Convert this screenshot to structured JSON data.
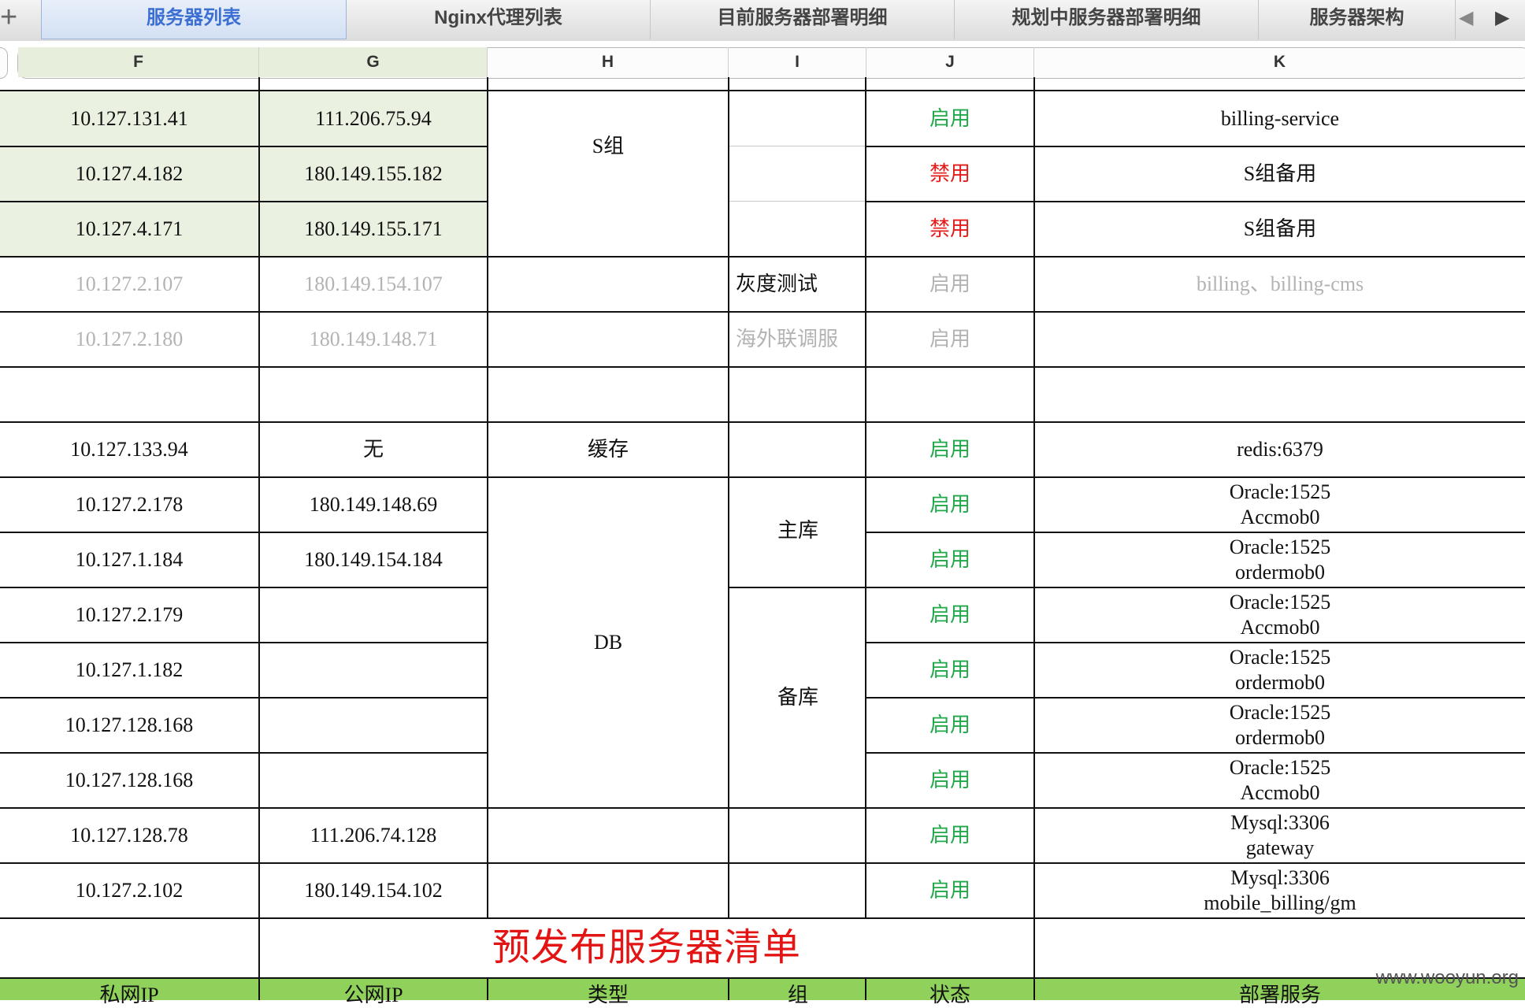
{
  "tabs": [
    {
      "label": "服务器列表",
      "active": true
    },
    {
      "label": "Nginx代理列表",
      "active": false
    },
    {
      "label": "目前服务器部署明细",
      "active": false
    },
    {
      "label": "规划中服务器部署明细",
      "active": false
    },
    {
      "label": "服务器架构",
      "active": false
    }
  ],
  "add_sheet_icon": "+",
  "nav_prev_icon": "◀",
  "nav_next_icon": "▶",
  "columns": [
    "F",
    "G",
    "H",
    "I",
    "J",
    "K"
  ],
  "rows": [
    {
      "private_ip": "10.127.131.41",
      "public_ip": "111.206.75.94",
      "status": "启用",
      "service": "billing-service"
    },
    {
      "private_ip": "10.127.4.182",
      "public_ip": "180.149.155.182",
      "status": "禁用",
      "service": "S组备用"
    },
    {
      "private_ip": "10.127.4.171",
      "public_ip": "180.149.155.171",
      "status": "禁用",
      "service": "S组备用"
    },
    {
      "private_ip": "10.127.2.107",
      "public_ip": "180.149.154.107",
      "group": "灰度测试",
      "status": "启用",
      "service": "billing、billing-cms"
    },
    {
      "private_ip": "10.127.2.180",
      "public_ip": "180.149.148.71",
      "group": "海外联调服",
      "status": "启用",
      "service": ""
    },
    {
      "private_ip": "",
      "public_ip": "",
      "group": "",
      "status": "",
      "service": ""
    },
    {
      "private_ip": "10.127.133.94",
      "public_ip": "无",
      "category": "缓存",
      "status": "启用",
      "service": "redis:6379"
    },
    {
      "private_ip": "10.127.2.178",
      "public_ip": "180.149.148.69",
      "status": "启用",
      "service": "Oracle:1525\nAccmob0"
    },
    {
      "private_ip": "10.127.1.184",
      "public_ip": "180.149.154.184",
      "status": "启用",
      "service": "Oracle:1525\nordermob0"
    },
    {
      "private_ip": "10.127.2.179",
      "public_ip": "",
      "status": "启用",
      "service": "Oracle:1525\nAccmob0"
    },
    {
      "private_ip": "10.127.1.182",
      "public_ip": "",
      "status": "启用",
      "service": "Oracle:1525\nordermob0"
    },
    {
      "private_ip": "10.127.128.168",
      "public_ip": "",
      "status": "启用",
      "service": "Oracle:1525\nordermob0"
    },
    {
      "private_ip": "10.127.128.168",
      "public_ip": "",
      "status": "启用",
      "service": "Oracle:1525\nAccmob0"
    },
    {
      "private_ip": "10.127.128.78",
      "public_ip": "111.206.74.128",
      "status": "启用",
      "service": "Mysql:3306\ngateway"
    },
    {
      "private_ip": "10.127.2.102",
      "public_ip": "180.149.154.102",
      "status": "启用",
      "service": "Mysql:3306\nmobile_billing/gm"
    }
  ],
  "merged": {
    "s_group": "S组",
    "db": "DB",
    "master": "主库",
    "standby": "备库"
  },
  "section_title": "预发布服务器清单",
  "header_row": [
    "私网IP",
    "公网IP",
    "类型",
    "组",
    "状态",
    "部署服务"
  ],
  "watermark": "www.wooyun.org",
  "colors": {
    "enabled": "#21a84a",
    "disabled": "#e31b1b",
    "title": "#e31414",
    "header_fill": "#8fd15b",
    "selected_fill": "#eaf1e1",
    "active_tab": "#3c6fd3"
  }
}
